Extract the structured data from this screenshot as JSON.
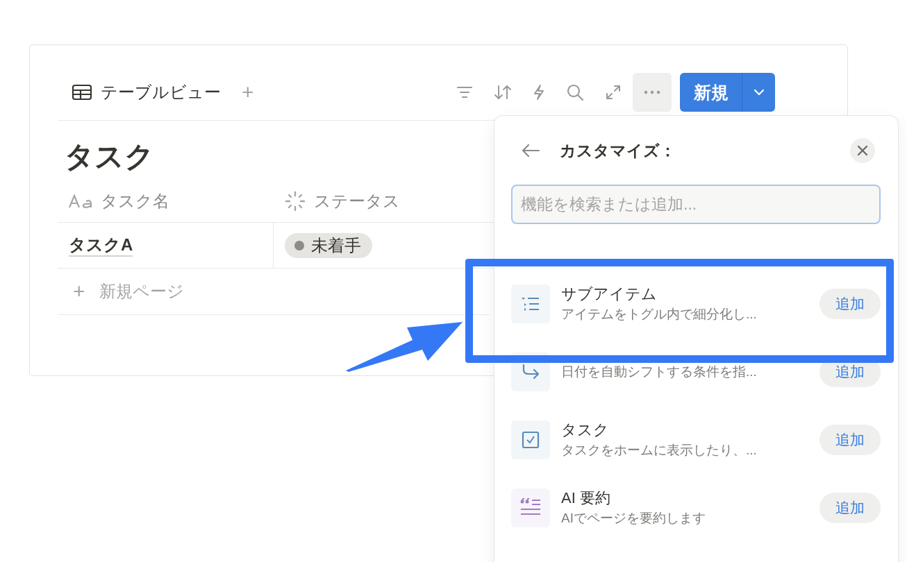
{
  "toolbar": {
    "view_label": "テーブルビュー",
    "add_view": "+",
    "new_button": "新規"
  },
  "database": {
    "title": "タスク",
    "columns": [
      {
        "label": "タスク名",
        "kind": "title"
      },
      {
        "label": "ステータス",
        "kind": "status"
      }
    ],
    "rows": [
      {
        "name": "タスクA",
        "status": "未着手"
      }
    ],
    "new_page_icon": "+",
    "new_page": "新規ページ"
  },
  "customize_panel": {
    "title": "カスタマイズ：",
    "search": {
      "placeholder": "機能を検索または追加..."
    },
    "items": [
      {
        "kind": "subitems",
        "title": "サブアイテム",
        "description": "アイテムをトグル内で細分化し...",
        "button": "追加"
      },
      {
        "kind": "dependency",
        "description": "日付を自動シフトする条件を指...",
        "button": "追加"
      },
      {
        "kind": "task",
        "title": "タスク",
        "description": "タスクをホームに表示したり、...",
        "button": "追加"
      },
      {
        "kind": "ai-summary",
        "title": "AI 要約",
        "description": "AIでページを要約します",
        "button": "追加"
      }
    ]
  }
}
